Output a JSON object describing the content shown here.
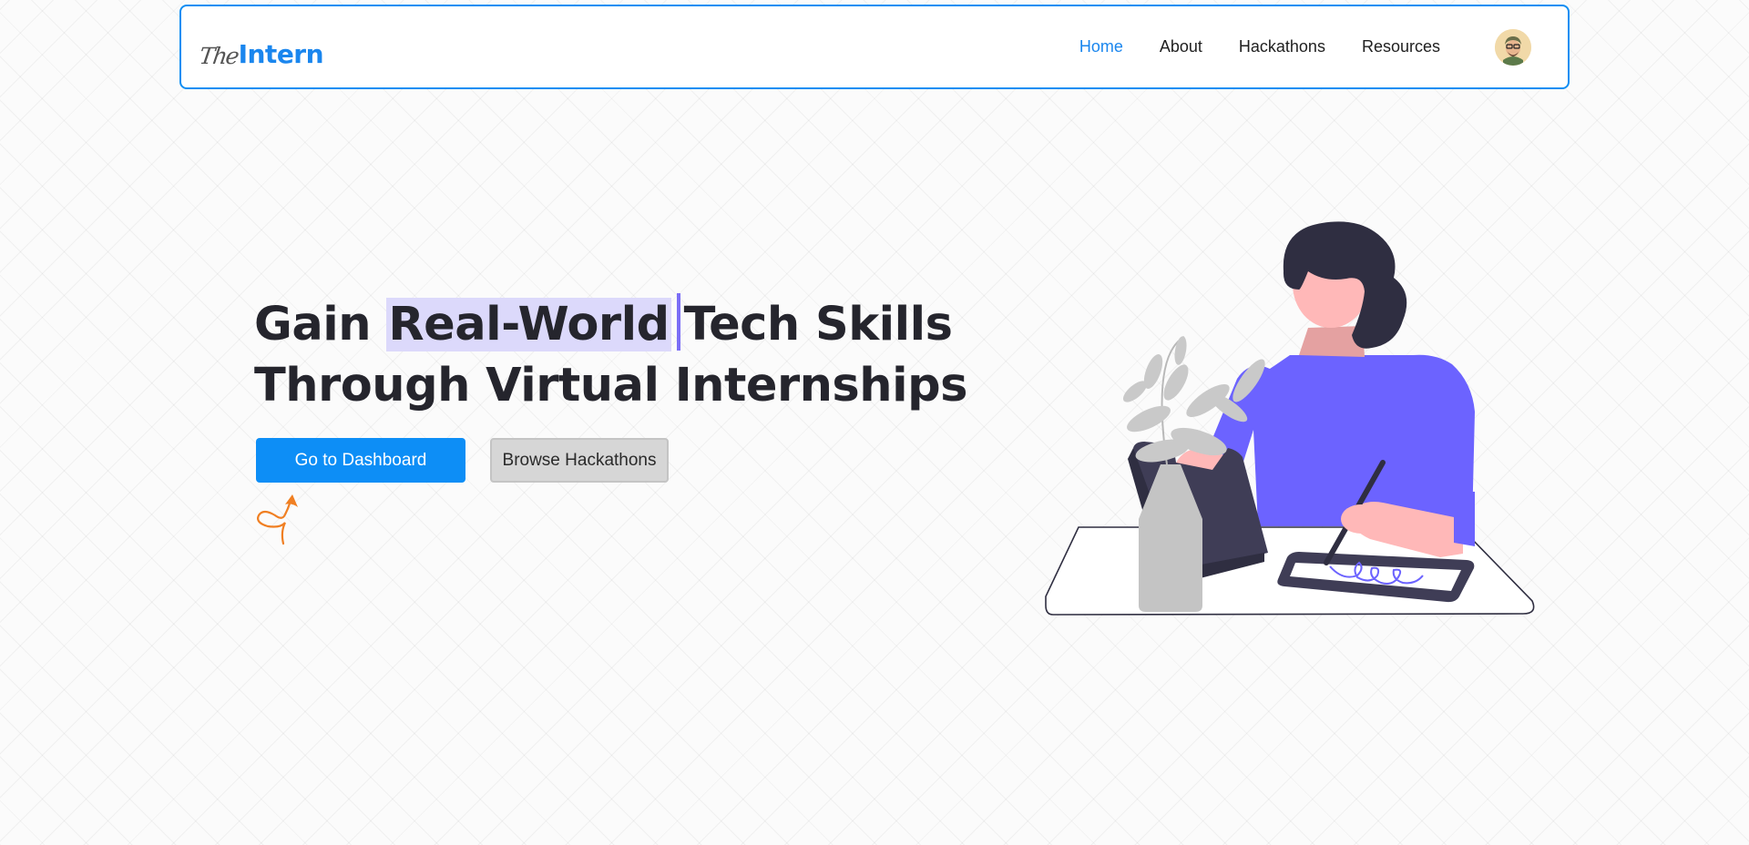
{
  "brand": {
    "logo_prefix": "The",
    "logo_name": "Intern",
    "color": "#1a86ee"
  },
  "nav": {
    "links": [
      {
        "label": "Home",
        "active": true
      },
      {
        "label": "About",
        "active": false
      },
      {
        "label": "Hackathons",
        "active": false
      },
      {
        "label": "Resources",
        "active": false
      }
    ],
    "avatar_icon": "user-avatar-icon"
  },
  "hero": {
    "line1_prefix": "Gain ",
    "line1_highlight": "Real-World",
    "line1_suffix": "Tech Skills",
    "line2": "Through Virtual Internships",
    "highlight_color": "#dcd9fb",
    "primary_button": "Go to Dashboard",
    "secondary_button": "Browse Hackathons"
  },
  "colors": {
    "accent": "#0d8ef6",
    "illustration_accent": "#6c63ff",
    "squiggle": "#f07f22"
  }
}
